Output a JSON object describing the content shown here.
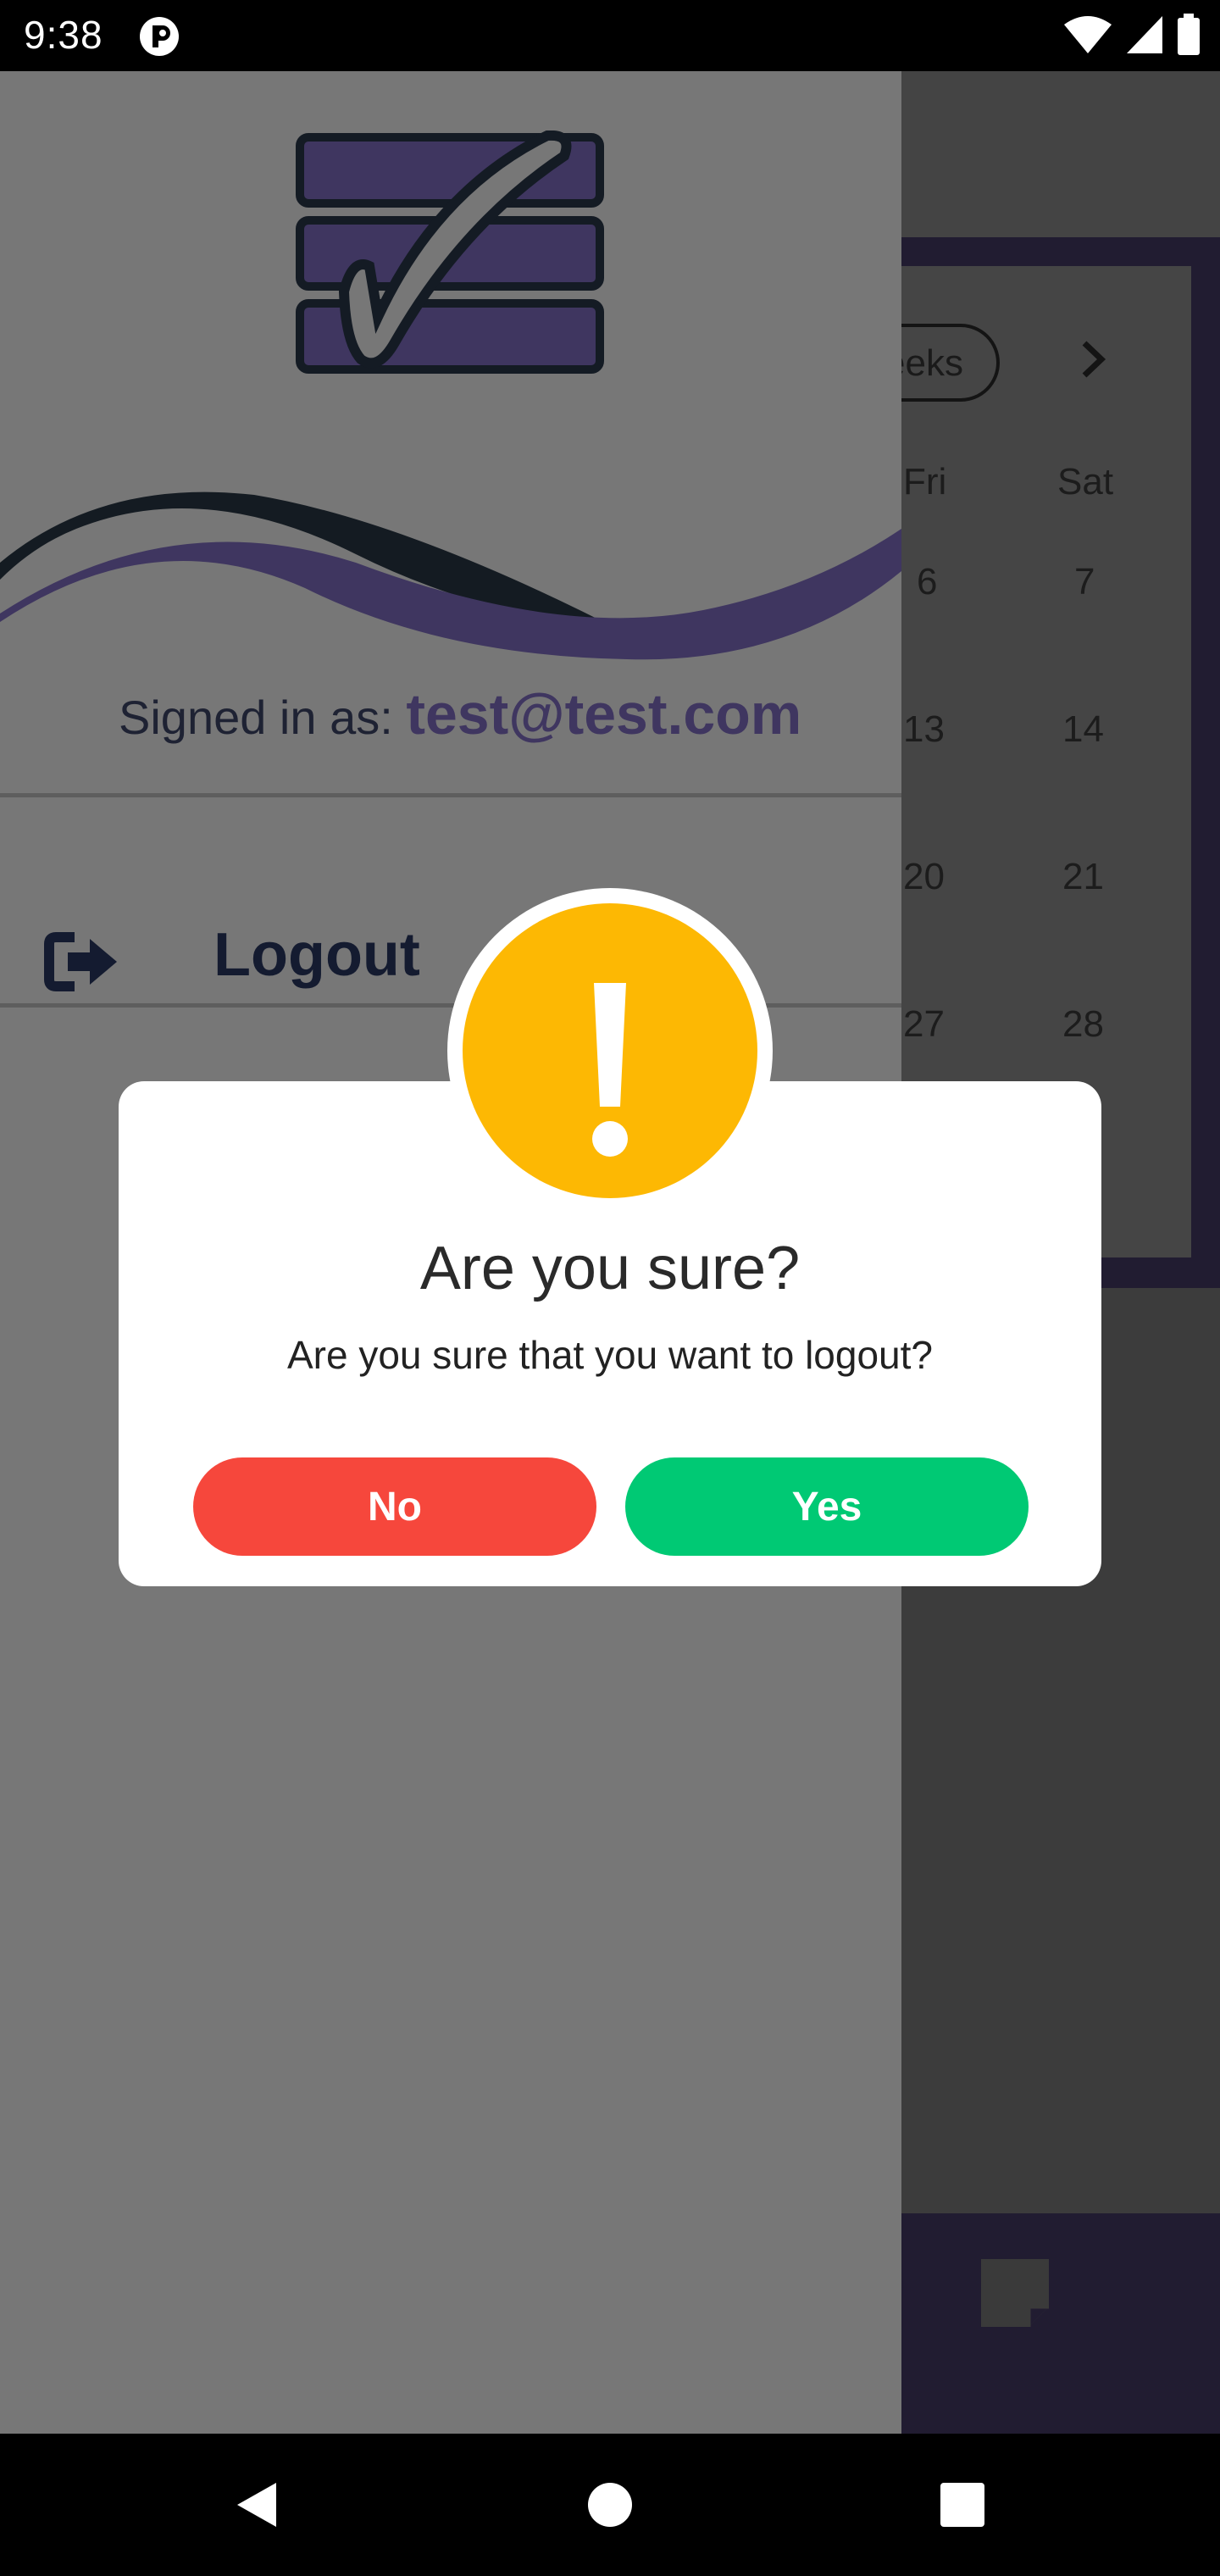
{
  "status_bar": {
    "time": "9:38"
  },
  "background": {
    "weeks_label": "eeks",
    "day_labels": [
      "Fri",
      "Sat"
    ],
    "rows": [
      [
        "6",
        "7"
      ],
      [
        "13",
        "14"
      ],
      [
        "20",
        "21"
      ],
      [
        "27",
        "28"
      ]
    ]
  },
  "drawer": {
    "signed_in_label": "Signed in as:",
    "email": "test@test.com",
    "logout_label": "Logout"
  },
  "dialog": {
    "title": "Are you sure?",
    "message": "Are you sure that you want to logout?",
    "no_label": "No",
    "yes_label": "Yes"
  },
  "colors": {
    "warning": "#fdb803",
    "no_button": "#f6473c",
    "yes_button": "#00c974",
    "brand_purple": "#3f3660"
  },
  "icons": [
    "app-notification-icon",
    "wifi-icon",
    "signal-icon",
    "battery-icon",
    "chevron-right-icon",
    "logout-icon",
    "note-icon",
    "back-icon",
    "home-icon",
    "recents-icon",
    "exclamation-icon"
  ]
}
